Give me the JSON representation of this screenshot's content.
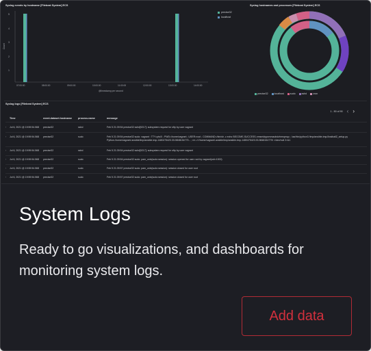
{
  "card": {
    "title": "System Logs",
    "description": "Ready to go visualizations, and dashboards for monitoring system logs.",
    "add_button_label": "Add data"
  },
  "preview": {
    "bar_panel": {
      "title": "Syslog events by hostname [Filebeat System] ECS",
      "legend": [
        "precise32",
        "localhost"
      ],
      "legend_colors": [
        "#54b399",
        "#6092c0"
      ]
    },
    "donut_panel": {
      "title": "Syslog hostnames and processes [Filebeat System] ECS",
      "legend": [
        "precise32",
        "localhost",
        "sudo",
        "sshd",
        "cron"
      ],
      "legend_colors": [
        "#54b399",
        "#6092c0",
        "#d36086",
        "#9170b8",
        "#ca8eae"
      ]
    },
    "logs_panel": {
      "title": "Syslog logs [Filebeat System] ECS",
      "pagination": "1 - 50 of 90",
      "columns": [
        "Time",
        "event.dataset.hostname",
        "process.name",
        "message"
      ],
      "rows": [
        {
          "time": "Jul 6, 2021 @ 19:59:54.568",
          "host": "precise32",
          "process": "sshd",
          "message": "Feb 5 21:39:54 precise32 sshd[9217]: subsystem request for sftp by user vagrant"
        },
        {
          "time": "Jul 6, 2021 @ 19:59:54.568",
          "host": "precise32",
          "process": "sudo",
          "message": "Feb 5 21:39:54 precise32 sudo: vagrant : TTY=pts/0 ; PWD=/home/vagrant ; USER=root ; COMMAND=/bin/sh -c echo BECOME-SUCCESS-nmsmktppxmmaobdzhrmqmqu ; /usr/bin/python3 /tmp/ansible-tmp/AnsiballZ_setup.py",
          "message2": "Python-/home/vagrant/.ansible/tmp/ansible-tmp-1480475423.33-5848154779... ; rm -rf /home/vagrant/.ansible/tmp/ansible-tmp-1480475423.33-5848154779/ >/dev/null 2>&1"
        },
        {
          "time": "Jul 6, 2021 @ 19:59:54.568",
          "host": "precise32",
          "process": "sshd",
          "message": "Feb 5 21:39:54 precise32 sshd[9217]: subsystem request for sftp by user vagrant"
        },
        {
          "time": "Jul 6, 2021 @ 19:59:54.568",
          "host": "precise32",
          "process": "sudo",
          "message": "Feb 5 21:39:54 precise32 sudo: pam_unix(sudo:session): session opened for user root by vagrant(uid=1000)"
        },
        {
          "time": "Jul 6, 2021 @ 19:59:54.568",
          "host": "precise32",
          "process": "sudo",
          "message": "Feb 5 21:39:57 precise32 sudo: pam_unix(sudo:session): session closed for user root"
        },
        {
          "time": "Jul 6, 2021 @ 19:59:54.568",
          "host": "precise32",
          "process": "sudo",
          "message": "Feb 5 21:39:57 precise32 sudo: pam_unix(sudo:session): session closed for user root"
        }
      ]
    }
  }
}
